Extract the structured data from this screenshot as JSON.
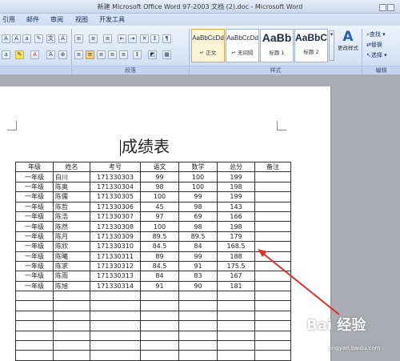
{
  "window": {
    "title": "新建 Microsoft Office Word 97-2003 文档 (2).doc - Microsoft Word"
  },
  "tabs": [
    {
      "label": "引用"
    },
    {
      "label": "邮件"
    },
    {
      "label": "审阅"
    },
    {
      "label": "视图"
    },
    {
      "label": "开发工具"
    }
  ],
  "ribbon": {
    "font_group_label": "",
    "paragraph_group_label": "段落",
    "styles_group_label": "样式",
    "editing_group_label": "编辑",
    "styles": [
      {
        "sample": "AaBbCcDd",
        "name": "↵ 正文"
      },
      {
        "sample": "AaBbCcDd",
        "name": "↵ 无间隔"
      },
      {
        "sample": "AaBb",
        "name": "标题 1"
      },
      {
        "sample": "AaBbC",
        "name": "标题 2"
      }
    ],
    "change_styles": "更改样式",
    "find": "查找 ▾",
    "replace": "替换",
    "select": "选择 ▾"
  },
  "document": {
    "title": "成绩表",
    "headers": [
      "年级",
      "姓名",
      "考号",
      "语文",
      "数学",
      "总分",
      "备注"
    ],
    "rows": [
      [
        "一年级",
        "白川",
        "171330303",
        "99",
        "100",
        "199",
        ""
      ],
      [
        "一年级",
        "陈奥",
        "171330304",
        "98",
        "100",
        "198",
        ""
      ],
      [
        "一年级",
        "陈儒",
        "171330305",
        "100",
        "99",
        "199",
        ""
      ],
      [
        "一年级",
        "陈哲",
        "171330306",
        "45",
        "98",
        "143",
        ""
      ],
      [
        "一年级",
        "陈浩",
        "171330307",
        "97",
        "69",
        "166",
        ""
      ],
      [
        "一年级",
        "陈然",
        "171330308",
        "100",
        "98",
        "198",
        ""
      ],
      [
        "一年级",
        "陈月",
        "171330309",
        "89.5",
        "89.5",
        "179",
        ""
      ],
      [
        "一年级",
        "陈欣",
        "171330310",
        "84.5",
        "84",
        "168.5",
        ""
      ],
      [
        "一年级",
        "陈曦",
        "171330311",
        "89",
        "99",
        "188",
        ""
      ],
      [
        "一年级",
        "陈求",
        "171330312",
        "84.5",
        "91",
        "175.5",
        ""
      ],
      [
        "一年级",
        "陈雨",
        "171330313",
        "84",
        "83",
        "167",
        ""
      ],
      [
        "一年级",
        "陈旭",
        "171330314",
        "91",
        "90",
        "181",
        ""
      ]
    ],
    "empty_rows": 7
  },
  "watermark": {
    "text": "Bai 经验",
    "url": "jingyan.baidu.com"
  },
  "colors": {
    "arrow": "#e0302a",
    "ribbon": "#d6e3f5"
  }
}
